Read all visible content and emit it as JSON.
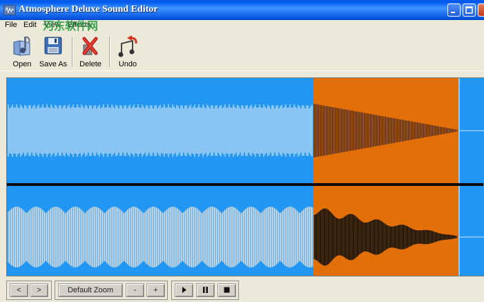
{
  "window": {
    "title": "Atmosphere Deluxe Sound Editor",
    "controls": [
      "minimize",
      "maximize",
      "close"
    ]
  },
  "menu": {
    "items": [
      "File",
      "Edit",
      "View",
      "Effects"
    ]
  },
  "watermark": {
    "text": "河东软件网",
    "url": "www.pc0359.cn"
  },
  "toolbar": {
    "open_label": "Open",
    "save_as_label": "Save As",
    "delete_label": "Delete",
    "undo_label": "Undo"
  },
  "waveform": {
    "background_color": "#2196f3",
    "selection_color": "#e36f08",
    "upper_wave_color": "#f2f2f2",
    "lower_wave_color": "#dedede",
    "selected_wave_color": "#111111",
    "tracks": 2
  },
  "controls": {
    "prev_label": "<",
    "next_label": ">",
    "zoom_label": "Default Zoom",
    "zoom_out_label": "-",
    "zoom_in_label": "+",
    "play_icon": "play-icon",
    "pause_icon": "pause-icon",
    "stop_icon": "stop-icon"
  }
}
